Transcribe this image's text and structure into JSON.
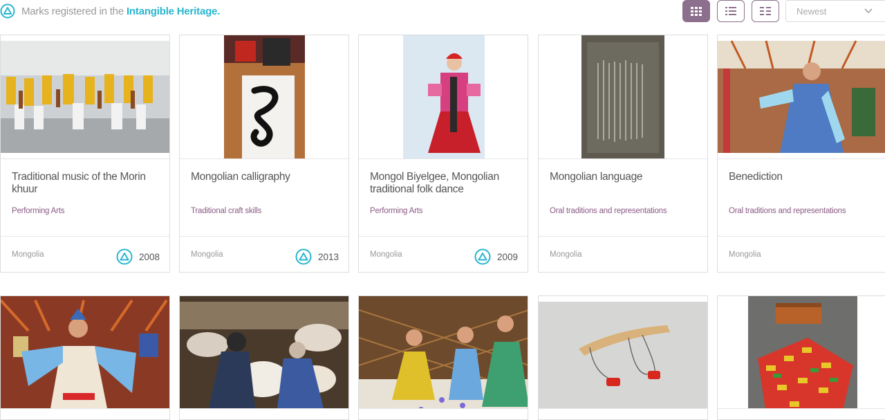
{
  "legend": {
    "prefix": "Marks registered in the",
    "highlight": "Intangible Heritage."
  },
  "sort": {
    "value": "Newest"
  },
  "cards": [
    {
      "title": "Traditional music of the Morin khuur",
      "category": "Performing Arts",
      "country": "Mongolia",
      "year": "2008"
    },
    {
      "title": "Mongolian calligraphy",
      "category": "Traditional craft skills",
      "country": "Mongolia",
      "year": "2013"
    },
    {
      "title": "Mongol Biyelgee, Mongolian traditional folk dance",
      "category": "Performing Arts",
      "country": "Mongolia",
      "year": "2009"
    },
    {
      "title": "Mongolian language",
      "category": "Oral traditions and representations",
      "country": "Mongolia",
      "year": ""
    },
    {
      "title": "Benediction",
      "category": "Oral traditions and representations",
      "country": "Mongolia",
      "year": ""
    }
  ],
  "colors": {
    "accent": "#8c6f8c",
    "heritage": "#27b6cf",
    "category": "#8a5a84"
  }
}
